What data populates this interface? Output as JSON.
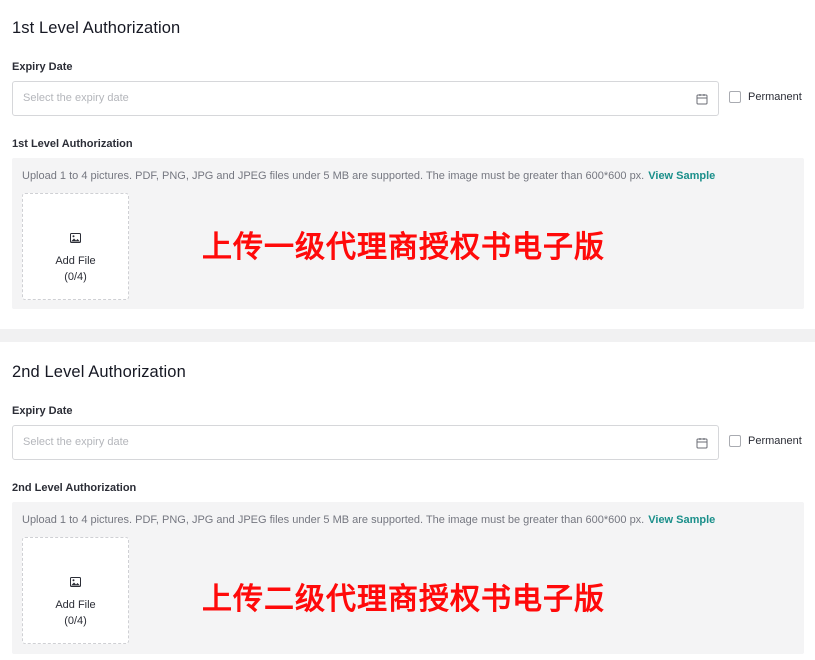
{
  "sections": [
    {
      "title": "1st Level Authorization",
      "expiry_label": "Expiry Date",
      "date_placeholder": "Select the expiry date",
      "permanent_label": "Permanent",
      "upload_label": "1st Level Authorization",
      "hint": "Upload 1 to 4 pictures. PDF, PNG, JPG and JPEG files under 5 MB are supported. The image must be greater than 600*600 px.",
      "hint_link": "View Sample",
      "add_file": "Add File",
      "count": "(0/4)",
      "overlay_text": "上传一级代理商授权书电子版"
    },
    {
      "title": "2nd Level Authorization",
      "expiry_label": "Expiry Date",
      "date_placeholder": "Select the expiry date",
      "permanent_label": "Permanent",
      "upload_label": "2nd Level Authorization",
      "hint": "Upload 1 to 4 pictures. PDF, PNG, JPG and JPEG files under 5 MB are supported. The image must be greater than 600*600 px.",
      "hint_link": "View Sample",
      "add_file": "Add File",
      "count": "(0/4)",
      "overlay_text": "上传二级代理商授权书电子版"
    }
  ],
  "icons": {
    "calendar": "calendar-icon",
    "image": "image-icon"
  },
  "colors": {
    "accent_link": "#1a8f8a",
    "overlay_red": "#ff0a0a",
    "panel_bg": "#f4f4f5"
  }
}
